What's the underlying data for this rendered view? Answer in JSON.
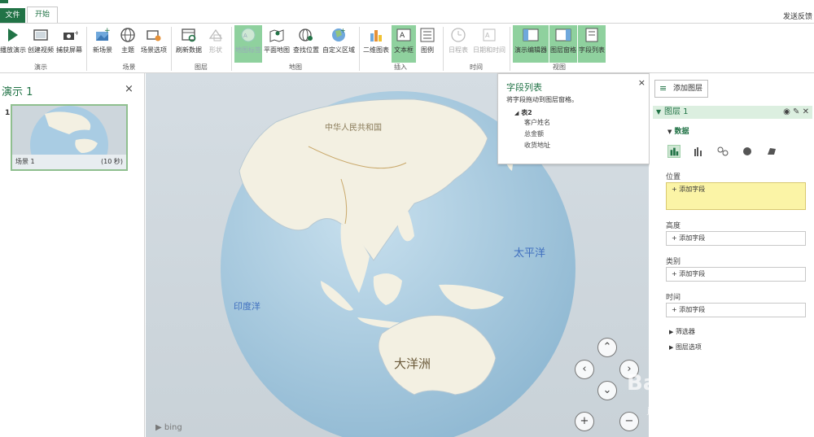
{
  "titlebar": {
    "file_tab": "文件",
    "home_tab": "开始",
    "feedback": "发送反馈"
  },
  "ribbon": {
    "buttons": {
      "play_tour": "播放演示",
      "create_video": "创建视频",
      "capture_screen": "捕获屏幕",
      "new_scene": "新场景",
      "themes": "主题",
      "scene_options": "场景选项",
      "refresh_data": "刷新数据",
      "shapes": "形状",
      "map_labels": "地图标签",
      "flat_map": "平面地图",
      "find_location": "查找位置",
      "custom_regions": "自定义区域",
      "chart_2d": "二维图表",
      "text_box": "文本框",
      "legend": "图例",
      "timeline": "日程表",
      "date_time": "日期和时间",
      "tour_editor": "演示编辑器",
      "layer_pane": "图层窗格",
      "field_list": "字段列表"
    },
    "groups": {
      "tour": "演示",
      "scene": "场景",
      "layer": "图层",
      "map": "地图",
      "insert": "插入",
      "time": "时间",
      "view": "视图"
    }
  },
  "left_panel": {
    "title": "演示 1",
    "close": "×",
    "scenes": [
      {
        "number": "1",
        "name": "场景 1",
        "duration": "(10 秒)"
      }
    ]
  },
  "map": {
    "labels": {
      "china": "中华人民共和国",
      "pacific": "太平洋",
      "indian": "印度洋",
      "oceania": "大洋洲"
    },
    "attribution": "bing"
  },
  "field_list": {
    "title": "字段列表",
    "close": "×",
    "hint": "将字段拖动到图层窗格。",
    "table": "表2",
    "fields": [
      "客户姓名",
      "总金额",
      "收货地址"
    ]
  },
  "right_panel": {
    "add_layer": "添加图层",
    "layer_name": "图层 1",
    "data_section": "数据",
    "sections": {
      "location": "位置",
      "height": "高度",
      "category": "类别",
      "time": "时间"
    },
    "add_field": "+ 添加字段",
    "filters": "筛选器",
    "layer_options": "图层选项"
  },
  "colors": {
    "accent": "#217346",
    "active_button": "#8fd19e",
    "location_box": "#fbf4a6",
    "ocean": "#a9cce3",
    "land": "#f3f0e2"
  },
  "watermark": {
    "brand": "Baidu经验",
    "url": "jingyan.baidu.com"
  }
}
